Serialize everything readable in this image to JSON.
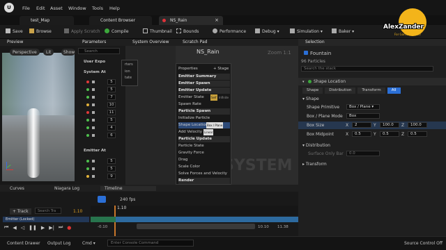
{
  "menu": {
    "logo": "U",
    "file_tab": "test_Map",
    "items": [
      "File",
      "Edit",
      "Asset",
      "Window",
      "Tools",
      "Help"
    ]
  },
  "tabs": {
    "content_browser": "Content Browser",
    "asset": "NS_Rain"
  },
  "toolbar": {
    "save": "Save",
    "browse": "Browse",
    "apply": "Apply Scratch",
    "compile": "Compile",
    "thumbnail": "Thumbnail",
    "bounds": "Bounds",
    "performance": "Performance",
    "debug": "Debug",
    "simulation": "Simulation",
    "baker": "Baker"
  },
  "preview": {
    "title": "Preview",
    "perspective": "Perspective",
    "lit": "Lit",
    "show": "Show"
  },
  "parameters": {
    "title": "Parameters",
    "search_placeholder": "Search",
    "user_exposed": "User Expo",
    "system_attr": "System At",
    "emitter_attr": "Emitter At",
    "values": [
      "5",
      "5",
      "7",
      "10",
      "11",
      "5",
      "4",
      "6",
      "5",
      "5",
      "9"
    ]
  },
  "system_overview": {
    "title": "System Overview",
    "items": [
      "rters",
      "ion",
      "tate"
    ]
  },
  "scratch": {
    "title": "Scratch Pad",
    "asset_title": "NS_Rain",
    "zoom": "Zoom 1:1",
    "watermark": "SYSTEM"
  },
  "node": {
    "properties": "Properties",
    "stage": "Stage",
    "rows": [
      "Emitter Summary",
      "Emitter Spawn",
      "Emitter Update",
      "Emitter State",
      "Spawn Rate",
      "Particle Spawn",
      "Initialize Particle",
      "Shape Location",
      "Add Velocity",
      "Particle Update",
      "Particle State",
      "Gravity Force",
      "Drag",
      "Scale Color",
      "Solve Forces and Velocity",
      "Render"
    ],
    "emitter_state_badge1": "Self",
    "emitter_state_badge2": "Infinite",
    "shape_badge": "Box / Plane",
    "velocity_badge": "Linear"
  },
  "selection": {
    "title": "Selection",
    "name": "Fountain",
    "particles": "96 Particles",
    "search_placeholder": "Search the stack",
    "module": "Shape Location",
    "tabs": [
      "Shape",
      "Distribution",
      "Transform",
      "All"
    ],
    "group_shape": "Shape",
    "shape_primitive_label": "Shape Primitive",
    "shape_primitive": "Box / Plane",
    "box_plane_mode_label": "Box / Plane Mode",
    "box_plane_mode": "Box",
    "box_size_label": "Box Size",
    "box_size": {
      "x_label": "X",
      "x": "2",
      "y_label": "Y",
      "y": "100.0",
      "z_label": "Z",
      "z": "100.0"
    },
    "box_midpoint_label": "Box Midpoint",
    "box_midpoint": {
      "x_label": "X",
      "x": "0.5",
      "y_label": "Y",
      "y": "0.5",
      "z_label": "Z",
      "z": "0.5"
    },
    "group_distribution": "Distribution",
    "surface_only_label": "Surface Only Bar",
    "surface_only_value": "0.0",
    "group_transform": "Transform"
  },
  "logo_text": {
    "main": "AlexZander",
    "sub": "For Game And Dev"
  },
  "timeline": {
    "tabs": [
      "Curves",
      "Niagara Log",
      "Timeline"
    ],
    "fps": "240 fps",
    "track": "+ Track",
    "search_placeholder": "Search Tra",
    "current_time": "1.10",
    "marker": "1.10",
    "left_time": "-0.10",
    "left_time2": "-0.10",
    "right_time": "10.10",
    "right_time2": "11.38",
    "track_label": "Emitter (Locked)"
  },
  "status": {
    "content_drawer": "Content Drawer",
    "output_log": "Output Log",
    "cmd": "Cmd",
    "console_placeholder": "Enter Console Command",
    "source_control": "Source Control Off"
  }
}
